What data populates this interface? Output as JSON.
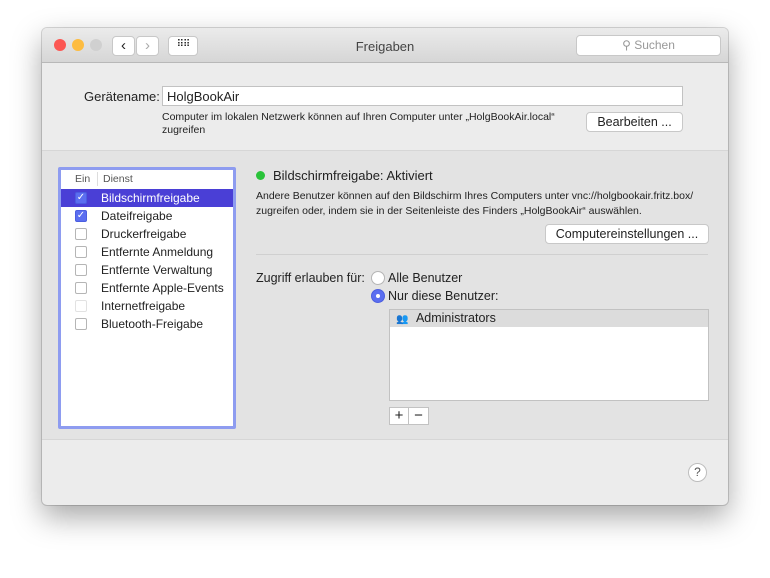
{
  "window": {
    "title": "Freigaben",
    "search_placeholder": "Suchen"
  },
  "device": {
    "label": "Gerätename:",
    "value": "HolgBookAir",
    "info": "Computer im lokalen Netzwerk können auf Ihren Computer unter „HolgBookAir.local“ zugreifen",
    "edit_button": "Bearbeiten ..."
  },
  "services": {
    "col_on": "Ein",
    "col_service": "Dienst",
    "items": [
      {
        "label": "Bildschirmfreigabe",
        "checked": true
      },
      {
        "label": "Dateifreigabe",
        "checked": true
      },
      {
        "label": "Druckerfreigabe",
        "checked": false
      },
      {
        "label": "Entfernte Anmeldung",
        "checked": false
      },
      {
        "label": "Entfernte Verwaltung",
        "checked": false
      },
      {
        "label": "Entfernte Apple-Events",
        "checked": false
      },
      {
        "label": "Internetfreigabe",
        "checked": false
      },
      {
        "label": "Bluetooth-Freigabe",
        "checked": false
      }
    ]
  },
  "detail": {
    "status": "Bildschirmfreigabe: Aktiviert",
    "status_color": "#2ac33a",
    "desc": "Andere Benutzer können auf den Bildschirm Ihres Computers unter vnc://holgbookair.fritz.box/ zugreifen oder, indem sie in der Seitenleiste des Finders „HolgBookAir“ auswählen.",
    "settings_button": "Computereinstellungen ...",
    "access_label": "Zugriff erlauben für:",
    "opt_all": "Alle Benutzer",
    "opt_only": "Nur diese Benutzer:",
    "selected": "only",
    "users": [
      "Administrators"
    ],
    "add": "+",
    "remove": "−"
  },
  "help": "?"
}
